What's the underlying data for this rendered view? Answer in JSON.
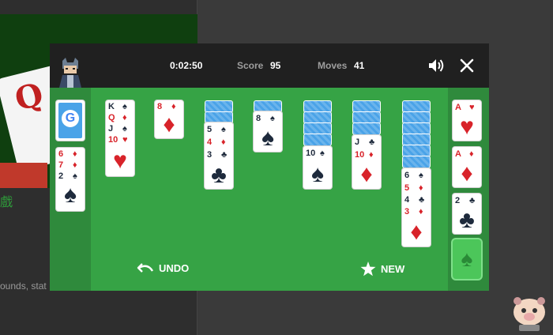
{
  "background": {
    "cn_text": "戲",
    "snippet": "ounds, stat"
  },
  "header": {
    "timer": "0:02:50",
    "score_label": "Score",
    "score_value": "95",
    "moves_label": "Moves",
    "moves_value": "41",
    "icons": [
      "avatar-icon",
      "volume-icon",
      "close-icon"
    ]
  },
  "stock": {
    "logo": "G"
  },
  "waste": [
    {
      "rank": "6",
      "suit": "♦"
    },
    {
      "rank": "7",
      "suit": "♦"
    },
    {
      "rank": "2",
      "suit": "♠"
    }
  ],
  "tableau": [
    {
      "faceup": [
        {
          "rank": "K",
          "suit": "♠"
        },
        {
          "rank": "Q",
          "suit": "♦"
        },
        {
          "rank": "J",
          "suit": "♠"
        },
        {
          "rank": "10",
          "suit": "♥"
        }
      ]
    },
    {
      "faceup": [
        {
          "rank": "8",
          "suit": "♦"
        }
      ]
    },
    {
      "facedown": 2,
      "faceup": [
        {
          "rank": "5",
          "suit": "♠"
        },
        {
          "rank": "4",
          "suit": "♦"
        },
        {
          "rank": "3",
          "suit": "♣"
        }
      ]
    },
    {
      "facedown": 1,
      "faceup": [
        {
          "rank": "8",
          "suit": "♠"
        }
      ]
    },
    {
      "facedown": 4,
      "faceup": [
        {
          "rank": "10",
          "suit": "♠"
        }
      ]
    },
    {
      "facedown": 3,
      "faceup": [
        {
          "rank": "J",
          "suit": "♣"
        },
        {
          "rank": "10",
          "suit": "♦"
        }
      ]
    },
    {
      "facedown": 6,
      "faceup": [
        {
          "rank": "6",
          "suit": "♠"
        },
        {
          "rank": "5",
          "suit": "♦"
        },
        {
          "rank": "4",
          "suit": "♣"
        },
        {
          "rank": "3",
          "suit": "♦"
        }
      ]
    }
  ],
  "foundations": [
    {
      "rank": "A",
      "suit": "♥"
    },
    {
      "rank": "A",
      "suit": "♦"
    },
    {
      "rank": "2",
      "suit": "♣"
    },
    {
      "rank": "",
      "suit": "♠",
      "empty": true
    }
  ],
  "footer": {
    "undo_label": "UNDO",
    "new_label": "NEW"
  },
  "colors": {
    "felt": "#36a345",
    "felt_dark": "#2f8a3c",
    "header": "#202020",
    "card_back": "#4aa3e8",
    "red": "#d8232a",
    "black": "#1e2a3c"
  }
}
